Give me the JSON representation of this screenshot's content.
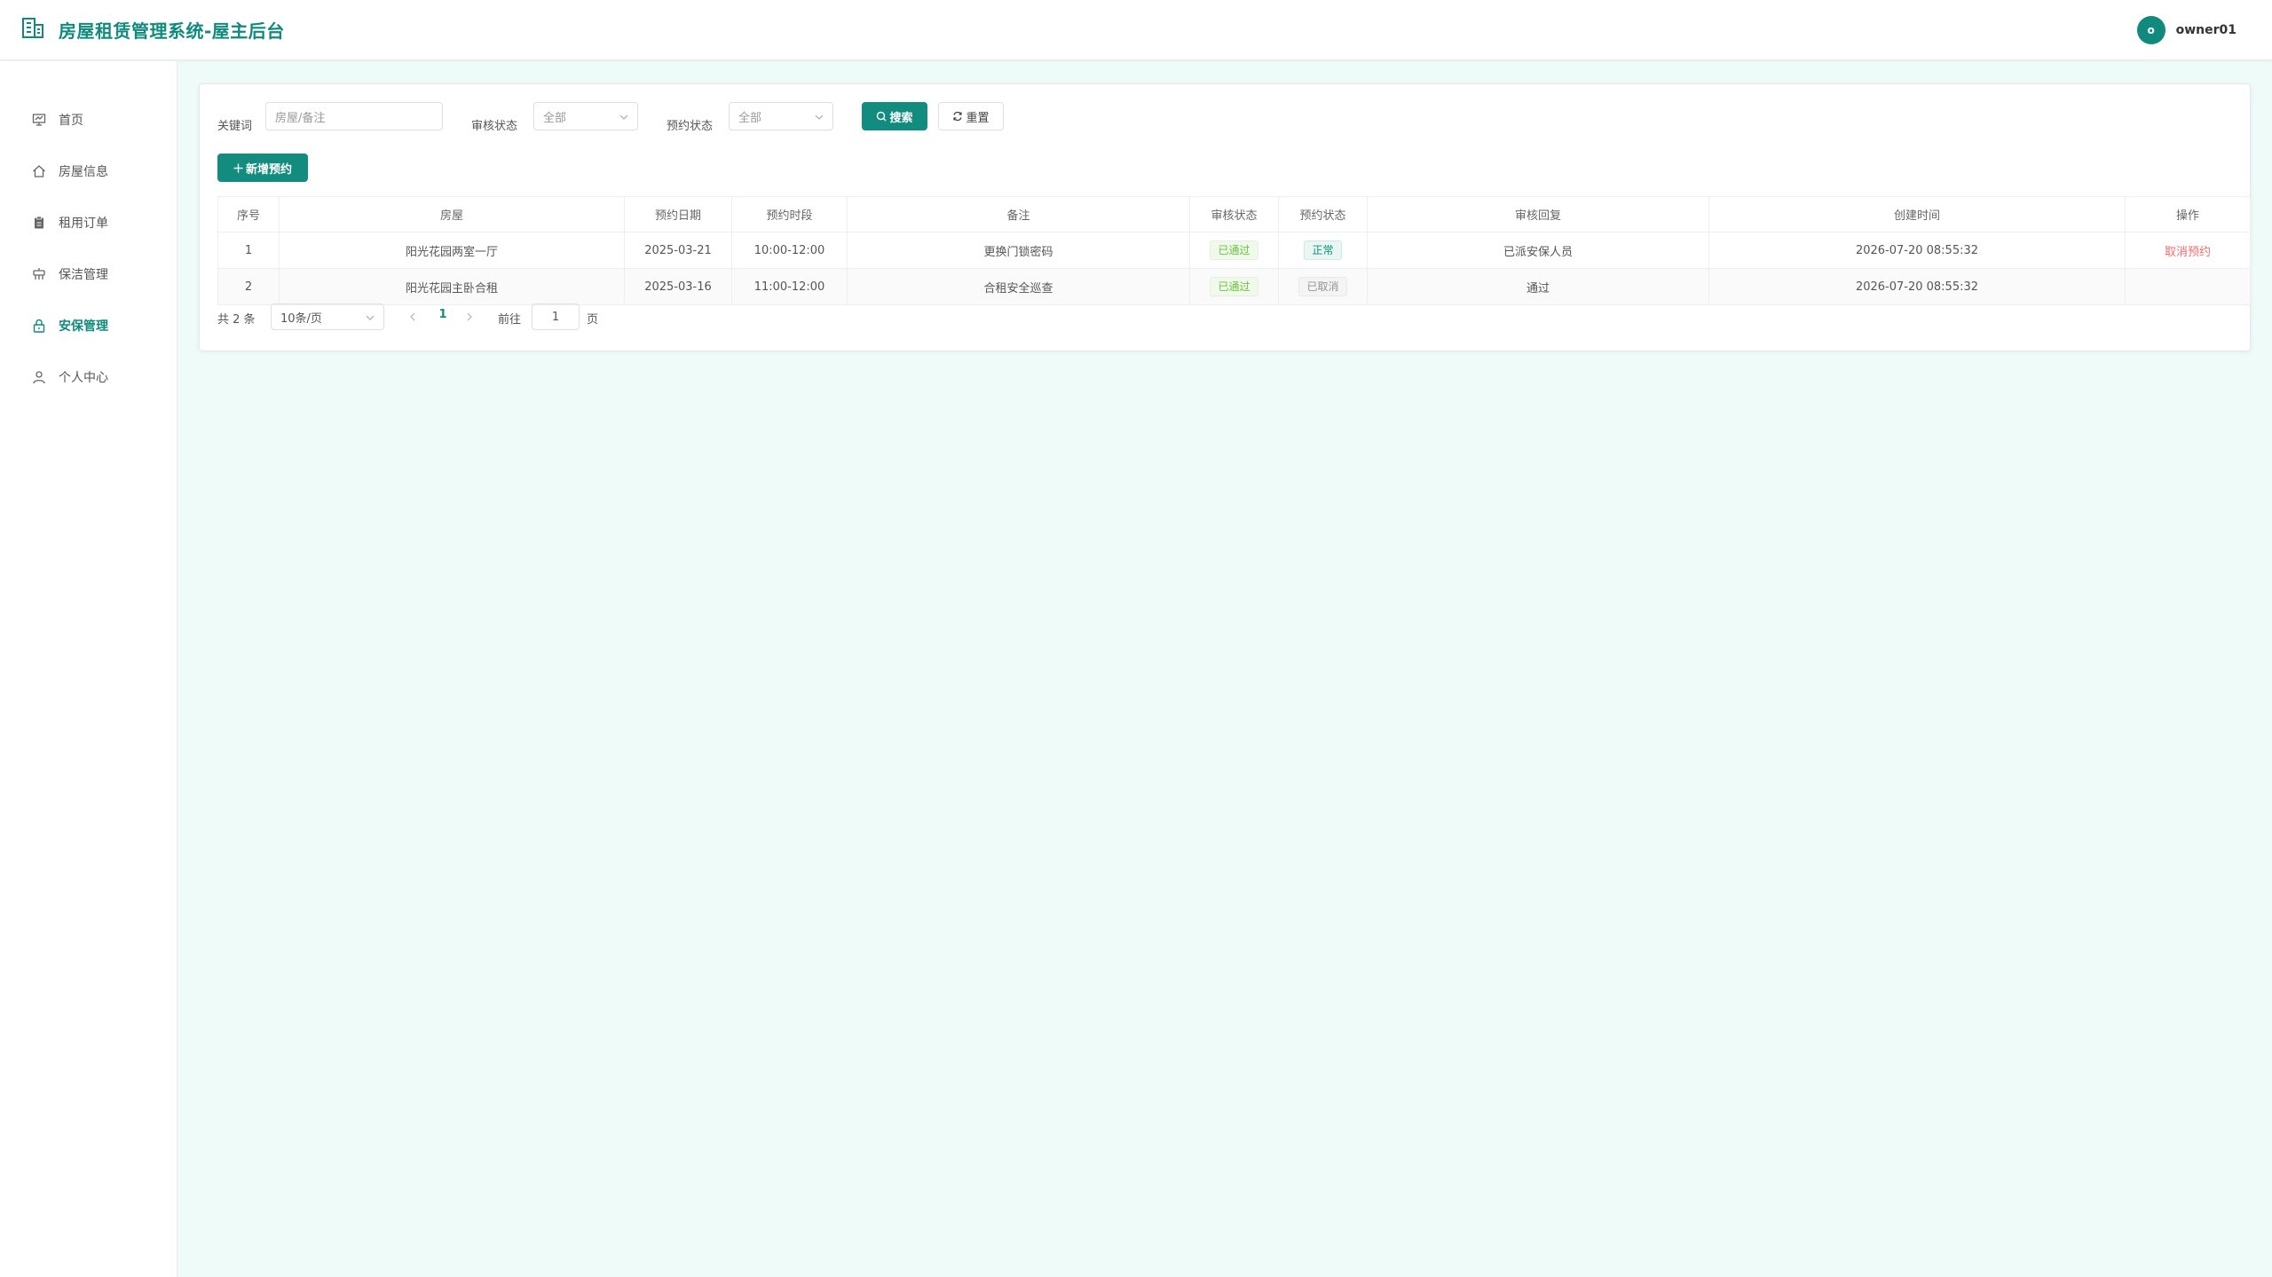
{
  "app": {
    "title": "房屋租赁管理系统-屋主后台",
    "avatar_letter": "o",
    "username": "owner01"
  },
  "colors": {
    "primary": "#128c7e",
    "danger": "#f56c6c",
    "success": "#67c23a",
    "page_bg": "#eefbf8"
  },
  "sidebar": {
    "items": [
      {
        "label": "首页",
        "icon": "home-monitor-icon"
      },
      {
        "label": "房屋信息",
        "icon": "house-icon"
      },
      {
        "label": "租用订单",
        "icon": "clipboard-icon"
      },
      {
        "label": "保洁管理",
        "icon": "cleaning-icon"
      },
      {
        "label": "安保管理",
        "icon": "lock-icon",
        "active": true
      },
      {
        "label": "个人中心",
        "icon": "user-icon"
      }
    ]
  },
  "filters": {
    "keyword_label": "关键词",
    "keyword_placeholder": "房屋/备注",
    "audit_label": "审核状态",
    "audit_value": "全部",
    "booking_label": "预约状态",
    "booking_value": "全部",
    "search_label": "搜索",
    "reset_label": "重置"
  },
  "add_button_label": "新增预约",
  "table": {
    "headers": [
      "序号",
      "房屋",
      "预约日期",
      "预约时段",
      "备注",
      "审核状态",
      "预约状态",
      "审核回复",
      "创建时间",
      "操作"
    ],
    "rows": [
      {
        "index": "1",
        "house": "阳光花园两室一厅",
        "date": "2025-03-21",
        "time": "10:00-12:00",
        "note": "更换门锁密码",
        "audit": "已通过",
        "booking": "正常",
        "reply": "已派安保人员",
        "created": "2026-07-20 08:55:32",
        "action": "取消预约"
      },
      {
        "index": "2",
        "house": "阳光花园主卧合租",
        "date": "2025-03-16",
        "time": "11:00-12:00",
        "note": "合租安全巡查",
        "audit": "已通过",
        "booking": "已取消",
        "reply": "通过",
        "created": "2026-07-20 08:55:32",
        "action": ""
      }
    ]
  },
  "pagination": {
    "total": "共 2 条",
    "page_size": "10条/页",
    "current": "1",
    "goto_label": "前往",
    "goto_value": "1",
    "page_suffix": "页"
  }
}
